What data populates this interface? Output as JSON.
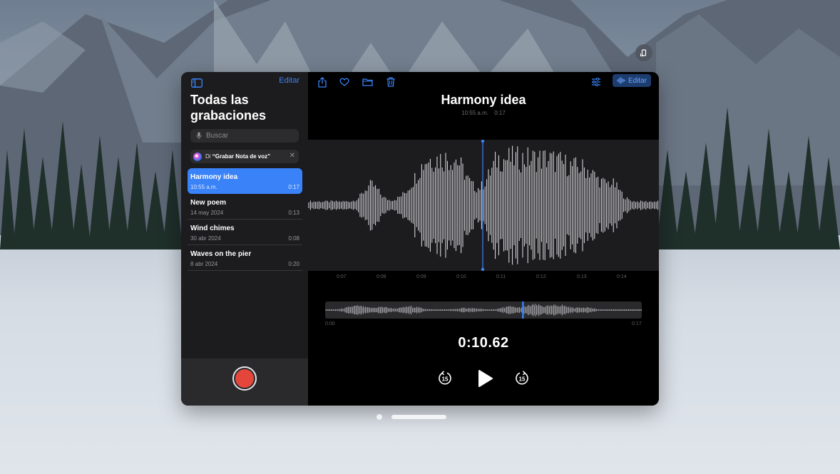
{
  "sidebar": {
    "edit_label": "Editar",
    "title": "Todas las grabaciones",
    "search_placeholder": "Buscar",
    "siri_tip": {
      "prefix": "Di ",
      "phrase": "“Grabar Nota de voz”"
    },
    "recordings": [
      {
        "name": "Harmony idea",
        "date": "10:55 a.m.",
        "duration": "0:17",
        "selected": true
      },
      {
        "name": "New poem",
        "date": "14 may 2024",
        "duration": "0:13",
        "selected": false
      },
      {
        "name": "Wind chimes",
        "date": "30 abr 2024",
        "duration": "0:08",
        "selected": false
      },
      {
        "name": "Waves on the pier",
        "date": "8 abr 2024",
        "duration": "0:20",
        "selected": false
      }
    ]
  },
  "toolbar": {
    "edit_label": "Editar"
  },
  "player": {
    "title": "Harmony idea",
    "time": "10:55 a.m.",
    "duration": "0:17",
    "ticks": [
      "0:07",
      "0:08",
      "0:09",
      "0:10",
      "0:11",
      "0:12",
      "0:13",
      "0:14"
    ],
    "overview_start": "0:00",
    "overview_end": "0:17",
    "current_time": "0:10.62",
    "skip_back_seconds": "15",
    "skip_forward_seconds": "15",
    "playhead_fraction": 0.6247
  },
  "colors": {
    "accent": "#3a82f7",
    "record": "#e5463b",
    "waveform": "#e5e5ea"
  },
  "icons": {
    "sidebar_toggle": "sidebar-icon",
    "share": "share-icon",
    "favorite": "heart-icon",
    "folder": "folder-icon",
    "trash": "trash-icon",
    "options": "sliders-icon",
    "edit_waveform": "waveform-icon",
    "mic": "mic-icon",
    "skip_back": "gobackward-15-icon",
    "play": "play-icon",
    "skip_forward": "goforward-15-icon"
  }
}
